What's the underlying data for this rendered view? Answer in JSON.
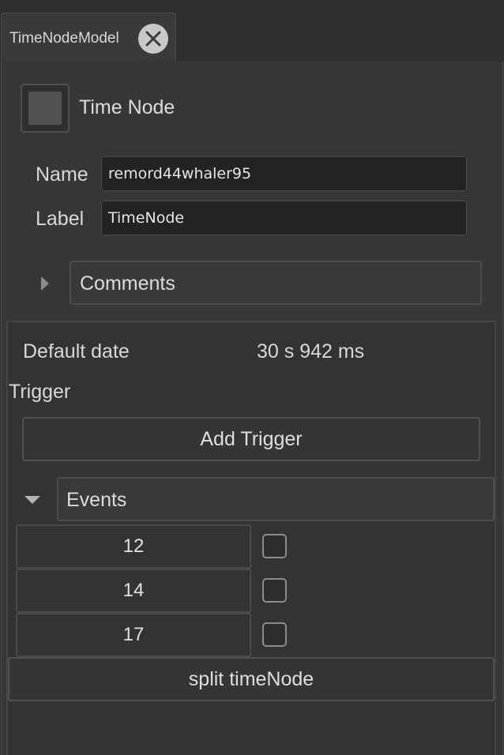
{
  "tab": {
    "label": "TimeNodeModel"
  },
  "header": {
    "title": "Time Node"
  },
  "fields": {
    "name_label": "Name",
    "name_value": "remord44whaler95",
    "label_label": "Label",
    "label_value": "TimeNode"
  },
  "comments": {
    "label": "Comments",
    "expanded": false
  },
  "timing": {
    "default_date_label": "Default date",
    "default_date_value": "30 s 942 ms"
  },
  "trigger": {
    "heading": "Trigger",
    "add_button": "Add Trigger"
  },
  "events": {
    "label": "Events",
    "expanded": true,
    "items": [
      {
        "label": "12",
        "checked": false
      },
      {
        "label": "14",
        "checked": false
      },
      {
        "label": "17",
        "checked": false
      }
    ]
  },
  "split_button": "split timeNode",
  "icons": {
    "close": "close-icon",
    "comments_expander": "triangle-right-icon",
    "events_expander": "triangle-down-icon"
  }
}
